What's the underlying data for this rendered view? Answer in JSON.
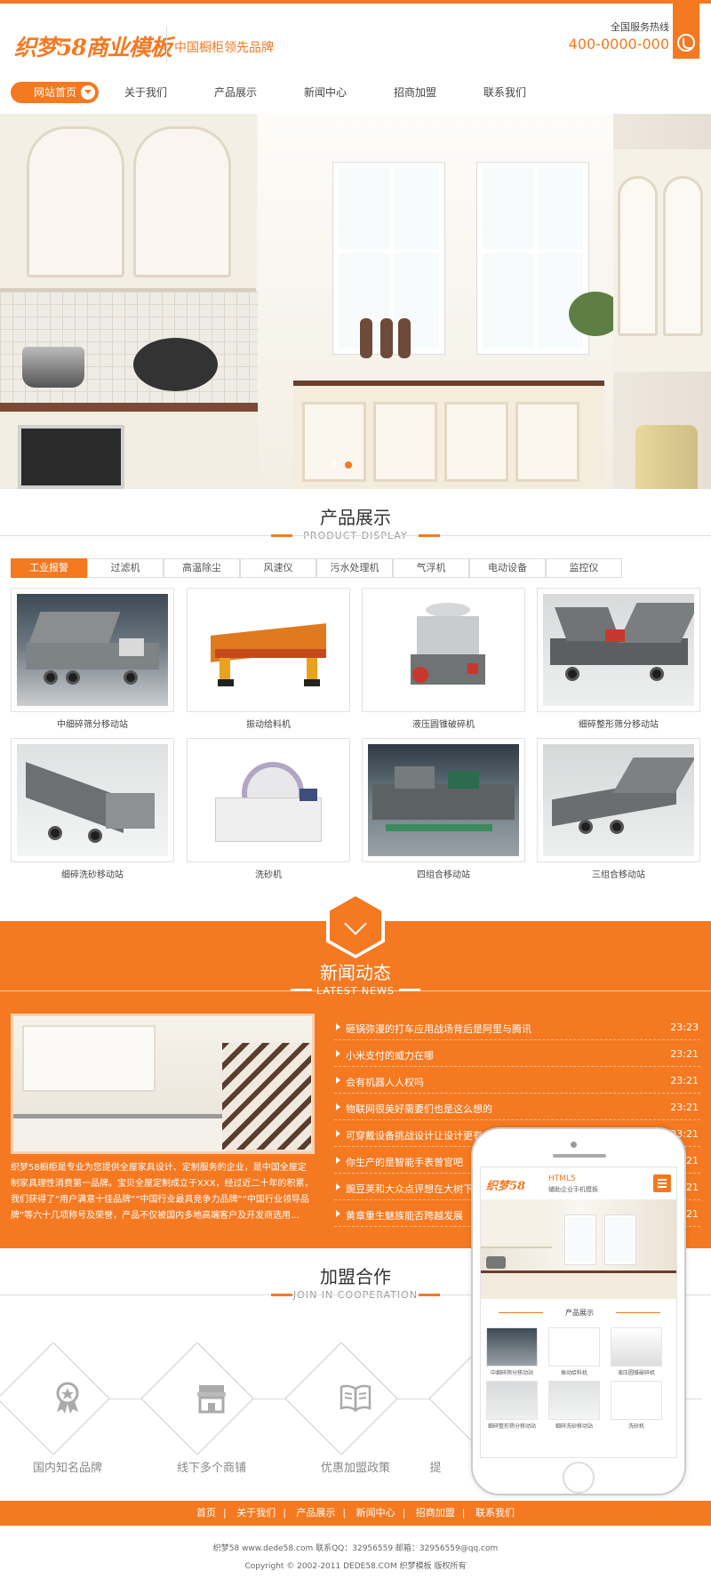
{
  "header": {
    "logo_text": "织梦58商业模板",
    "slogan": "中国橱柜领先品牌",
    "hotline_label": "全国服务热线",
    "hotline_number": "400-0000-000"
  },
  "nav": {
    "active_label": "网站首页",
    "items": [
      "关于我们",
      "产品展示",
      "新闻中心",
      "招商加盟",
      "联系我们"
    ]
  },
  "products": {
    "title": "产品展示",
    "subtitle": "PRODUCT DISPLAY",
    "tabs": [
      "工业报警",
      "过滤机",
      "高温除尘",
      "风速仪",
      "污水处理机",
      "气浮机",
      "电动设备",
      "监控仪"
    ],
    "items": [
      {
        "label": "中细碎筛分移动站"
      },
      {
        "label": "振动给料机"
      },
      {
        "label": "液压圆锥破碎机"
      },
      {
        "label": "细碎整形筛分移动站"
      },
      {
        "label": "细碎洗砂移动站"
      },
      {
        "label": "洗砂机"
      },
      {
        "label": "四组合移动站"
      },
      {
        "label": "三组合移动站"
      }
    ]
  },
  "news": {
    "title": "新闻动态",
    "subtitle": "LATEST NEWS",
    "description": "织梦58橱柜是专业为您提供全屋家具设计、定制服务的企业，是中国全屋定制家具理性消费第一品牌。宝贝全屋定制成立于XXX，经过近二十年的积累，我们获得了“用户满意十佳品牌”“中国行业最具竞争力品牌”“中国行业领导品牌”等六十几项称号及荣誉，产品不仅被国内多地高端客户及开发商选用...",
    "items": [
      {
        "title": "砸锅弥漫的打车应用战场背后是阿里与腾讯",
        "date": "23:23"
      },
      {
        "title": "小米支付的威力在哪",
        "date": "23:21"
      },
      {
        "title": "会有机器人人权吗",
        "date": "23:21"
      },
      {
        "title": "物联网很美好需要们也是这么想的",
        "date": "23:21"
      },
      {
        "title": "可穿戴设备挑战设计让设计更有",
        "date": "23:21"
      },
      {
        "title": "你生产的是智能手表曾官吧",
        "date": "23:21"
      },
      {
        "title": "豌豆荚和大众点评想在大树下",
        "date": "23:21"
      },
      {
        "title": "黄章重生魅族能否跨越发展",
        "date": "23:21"
      }
    ]
  },
  "join": {
    "title": "加盟合作",
    "subtitle": "JOIN IN COOPERATION",
    "items": [
      {
        "label": "国内知名品牌",
        "icon": "medal-icon"
      },
      {
        "label": "线下多个商铺",
        "icon": "store-icon"
      },
      {
        "label": "优惠加盟政策",
        "icon": "book-icon"
      },
      {
        "label": "提",
        "icon": "support-icon"
      }
    ]
  },
  "mobile": {
    "logo_text": "织梦58",
    "html5_label": "HTML5",
    "tagline": "辅助企业手机模板",
    "section_title": "产品展示",
    "products": [
      "中细碎筛分移动站",
      "振动给料机",
      "液压圆锥破碎机",
      "细碎整形筛分移动站",
      "细碎洗砂移动站",
      "洗砂机"
    ]
  },
  "footer": {
    "nav": [
      "首页",
      "关于我们",
      "产品展示",
      "新闻中心",
      "招商加盟",
      "联系我们"
    ],
    "contact": "织梦58 www.dede58.com 联系QQ：32956559 邮箱：32956559@qq.com",
    "copyright": "Copyright © 2002-2011 DEDE58.COM 织梦模板 版权所有"
  },
  "colors": {
    "accent": "#f57921",
    "text": "#333333"
  }
}
